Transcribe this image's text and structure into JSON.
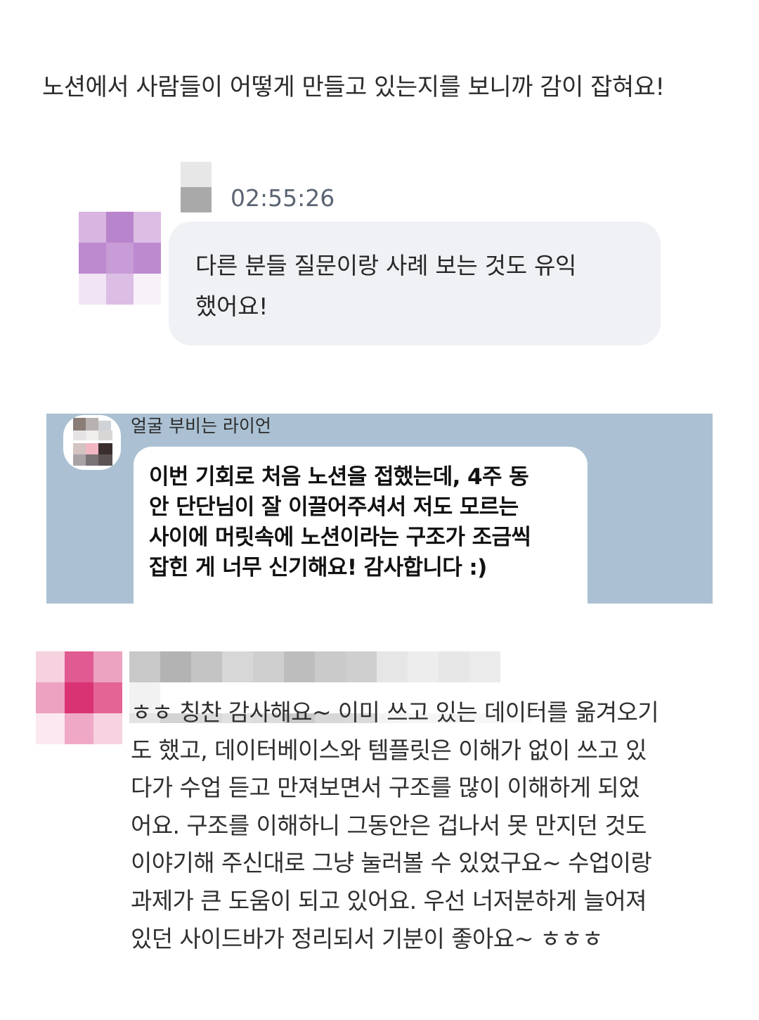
{
  "message1": {
    "text": "노션에서 사람들이 어떻게 만들고 있는지를 보니까 감이 잡혀요!"
  },
  "message2": {
    "timestamp": "02:55:26",
    "lines": [
      "다른 분들 질문이랑 사례 보는 것도 유익",
      "했어요!"
    ]
  },
  "message3": {
    "sender": "얼굴 부비는 라이언",
    "lines": [
      "이번 기회로 처음 노션을 접했는데, 4주 동",
      "안 단단님이 잘 이끌어주셔서 저도 모르는",
      "사이에 머릿속에 노션이라는 구조가 조금씩",
      "잡힌 게 너무 신기해요! 감사합니다 :)"
    ]
  },
  "message4": {
    "lines": [
      "ㅎㅎ 칭찬 감사해요~ 이미 쓰고 있는 데이터를 옮겨오기",
      "도 했고, 데이터베이스와 템플릿은 이해가 없이 쓰고 있",
      "다가 수업 듣고 만져보면서 구조를 많이 이해하게 되었",
      "어요. 구조를 이해하니 그동안은 겁나서 못 만지던 것도",
      "이야기해 주신대로 그냥 눌러볼 수 있었구요~ 수업이랑",
      "과제가 큰 도움이 되고 있어요. 우선 너저분하게 늘어져",
      "있던 사이드바가 정리되서 기분이 좋아요~ ㅎㅎㅎ"
    ]
  },
  "colors": {
    "bubble_gray": "#f0f1f5",
    "kakao_background": "#abc1d3",
    "timestamp": "#5b6473"
  }
}
